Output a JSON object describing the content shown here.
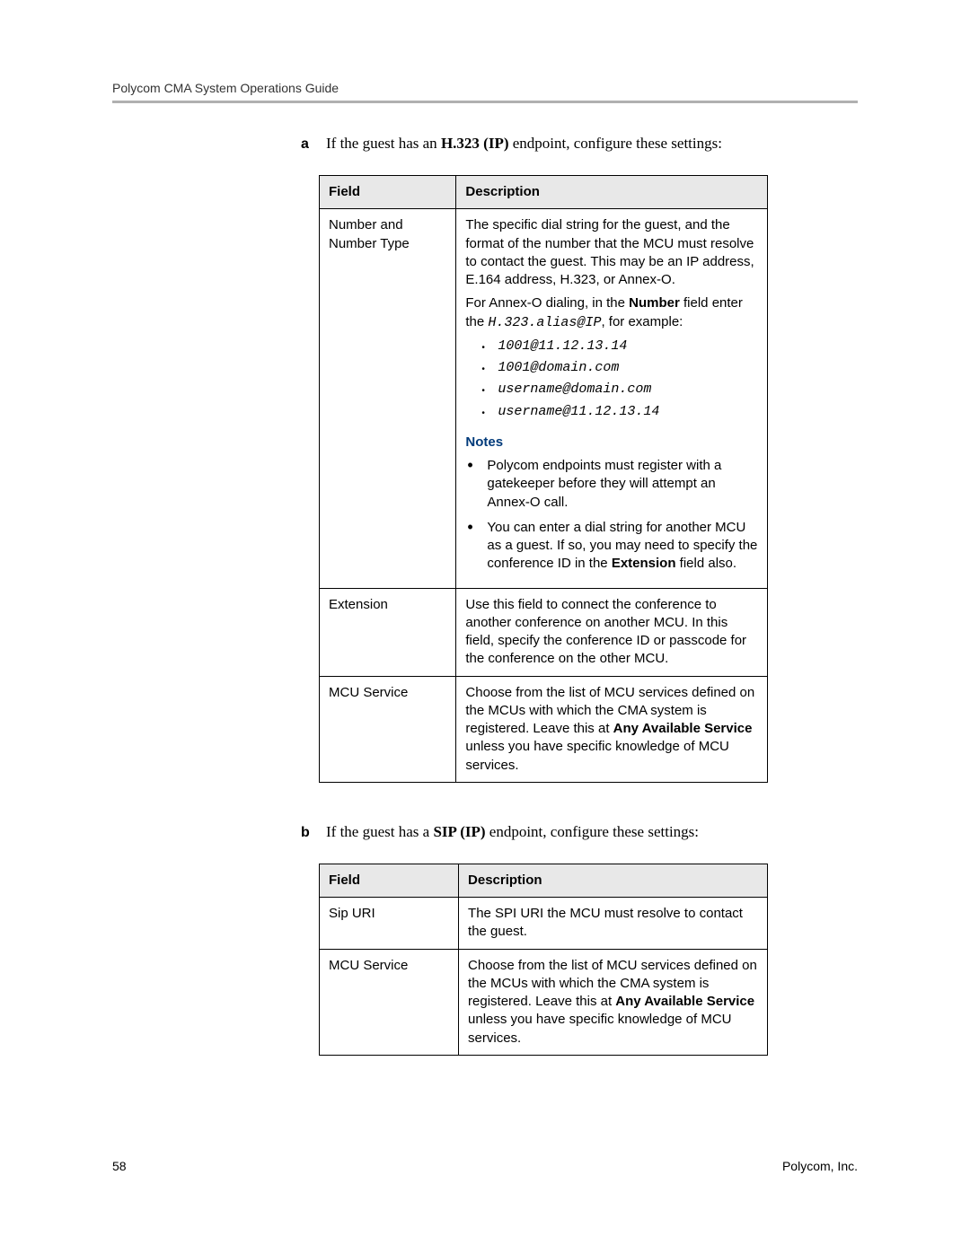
{
  "header": {
    "title": "Polycom CMA System Operations Guide"
  },
  "section_a": {
    "label": "a",
    "text_before": "If the guest has an ",
    "bold": "H.323 (IP)",
    "text_after": " endpoint, configure these settings:",
    "table": {
      "header_field": "Field",
      "header_desc": "Description",
      "rows": [
        {
          "field": "Number and Number Type",
          "p1": "The specific dial string for the guest, and the format of the number that the MCU must resolve to contact the guest. This may be an IP address, E.164 address, H.323, or Annex-O.",
          "p2_before": "For Annex-O dialing, in the ",
          "p2_bold": "Number",
          "p2_mid": " field enter the ",
          "p2_mono": "H.323.alias@IP",
          "p2_after": ", for example:",
          "examples": [
            "1001@11.12.13.14",
            "1001@domain.com",
            "username@domain.com",
            "username@11.12.13.14"
          ],
          "notes_heading": "Notes",
          "notes": [
            {
              "text": "Polycom endpoints must register with a gatekeeper before they will attempt an Annex-O call."
            },
            {
              "before": "You can enter a dial string for another MCU as a guest. If so, you may need to specify the conference ID in the ",
              "bold": "Extension",
              "after": " field also."
            }
          ]
        },
        {
          "field": "Extension",
          "desc": "Use this field to connect the conference to another conference on another MCU. In this field, specify the conference ID or passcode for the conference on the other MCU."
        },
        {
          "field": "MCU Service",
          "desc_before": "Choose from the list of MCU services defined on the MCUs with which the CMA system is registered. Leave this at ",
          "desc_bold": "Any Available Service",
          "desc_after": " unless you have specific knowledge of MCU services."
        }
      ]
    }
  },
  "section_b": {
    "label": "b",
    "text_before": "If the guest has a ",
    "bold": "SIP (IP)",
    "text_after": " endpoint, configure these settings:",
    "table": {
      "header_field": "Field",
      "header_desc": "Description",
      "rows": [
        {
          "field": "Sip URI",
          "desc": "The SPI URI the MCU must resolve to contact the guest."
        },
        {
          "field": "MCU Service",
          "desc_before": "Choose from the list of MCU services defined on the MCUs with which the CMA system is registered. Leave this at ",
          "desc_bold": "Any Available Service",
          "desc_after": " unless you have specific knowledge of MCU services."
        }
      ]
    }
  },
  "footer": {
    "page": "58",
    "company": "Polycom, Inc."
  }
}
